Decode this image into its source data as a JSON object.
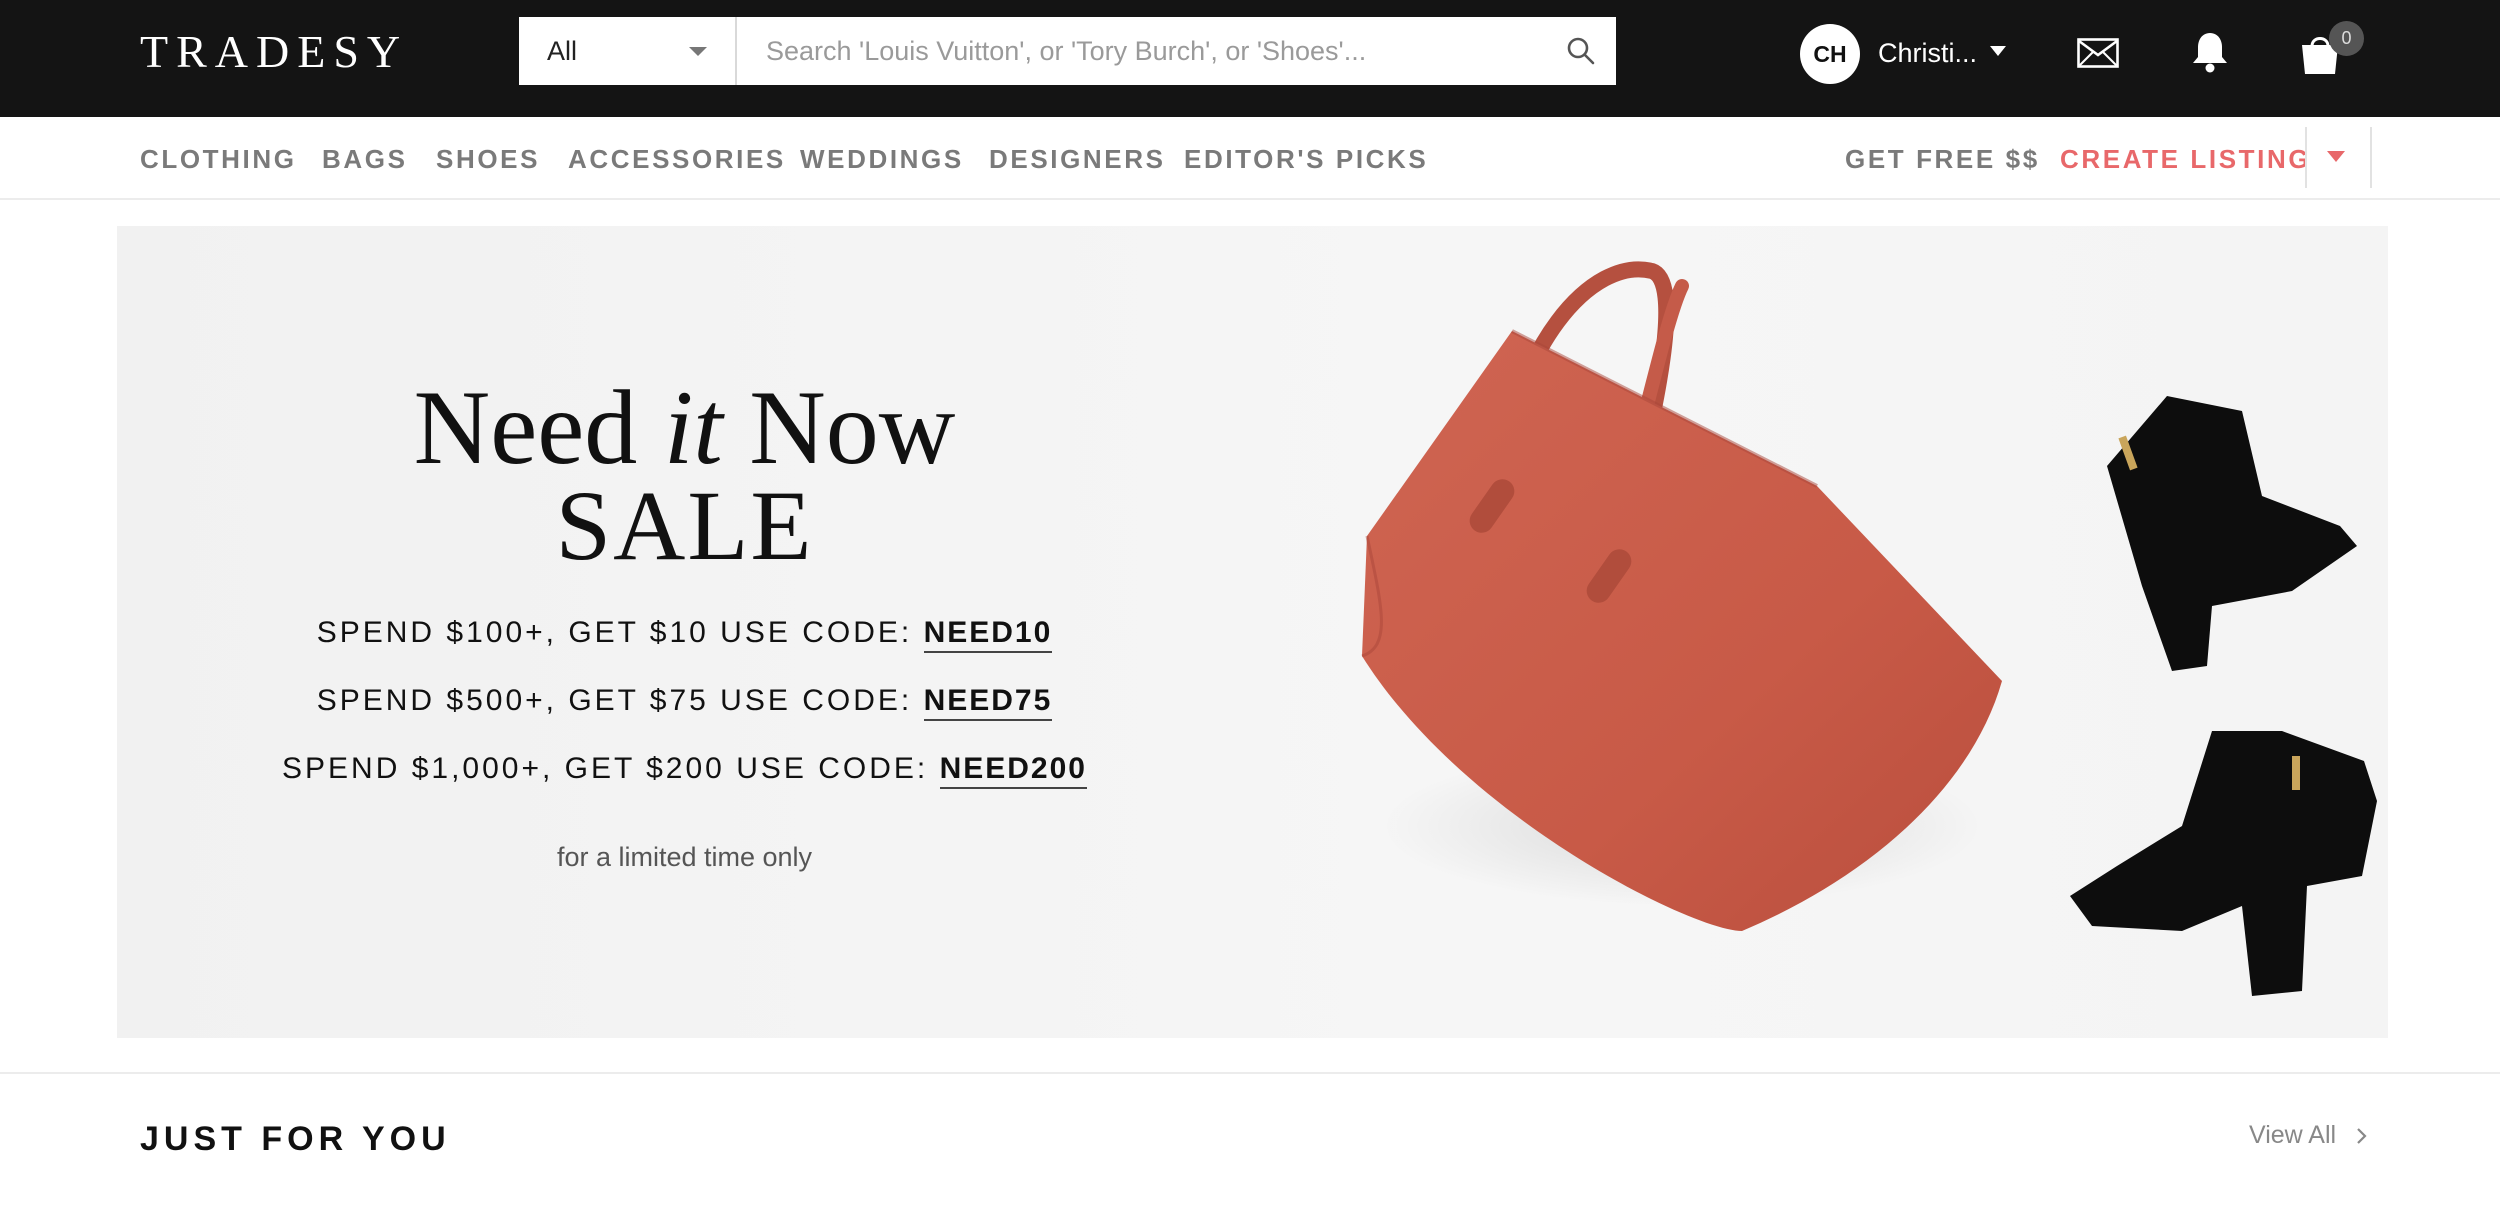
{
  "header": {
    "logo": "TRADESY",
    "search": {
      "category": "All",
      "placeholder": "Search 'Louis Vuitton', or 'Tory Burch', or 'Shoes'..."
    },
    "user": {
      "initials": "CH",
      "name": "Christi..."
    },
    "cart_count": "0",
    "icons": [
      "search-icon",
      "chevron-down-icon",
      "mail-icon",
      "bell-icon",
      "shopping-bag-icon"
    ]
  },
  "nav": {
    "items": [
      "CLOTHING",
      "BAGS",
      "SHOES",
      "ACCESSORIES",
      "WEDDINGS",
      "DESIGNERS",
      "EDITOR'S PICKS"
    ],
    "get_free": "GET FREE $$",
    "create_listing": "CREATE LISTING"
  },
  "banner": {
    "headline_pre": "Need",
    "headline_it": "it",
    "headline_post": "Now",
    "sale": "SALE",
    "offers": [
      {
        "text": "SPEND $100+, GET $10 USE CODE:",
        "code": "NEED10"
      },
      {
        "text": "SPEND $500+, GET $75 USE CODE:",
        "code": "NEED75"
      },
      {
        "text": "SPEND $1,000+, GET $200 USE CODE:",
        "code": "NEED200"
      }
    ],
    "footnote": "for a limited time only"
  },
  "section": {
    "title": "JUST FOR YOU",
    "view_all": "View All"
  },
  "colors": {
    "topbar": "#141414",
    "accent_red": "#e8686a",
    "nav_gray": "#7a7a7a",
    "tote": "#c95a47"
  }
}
